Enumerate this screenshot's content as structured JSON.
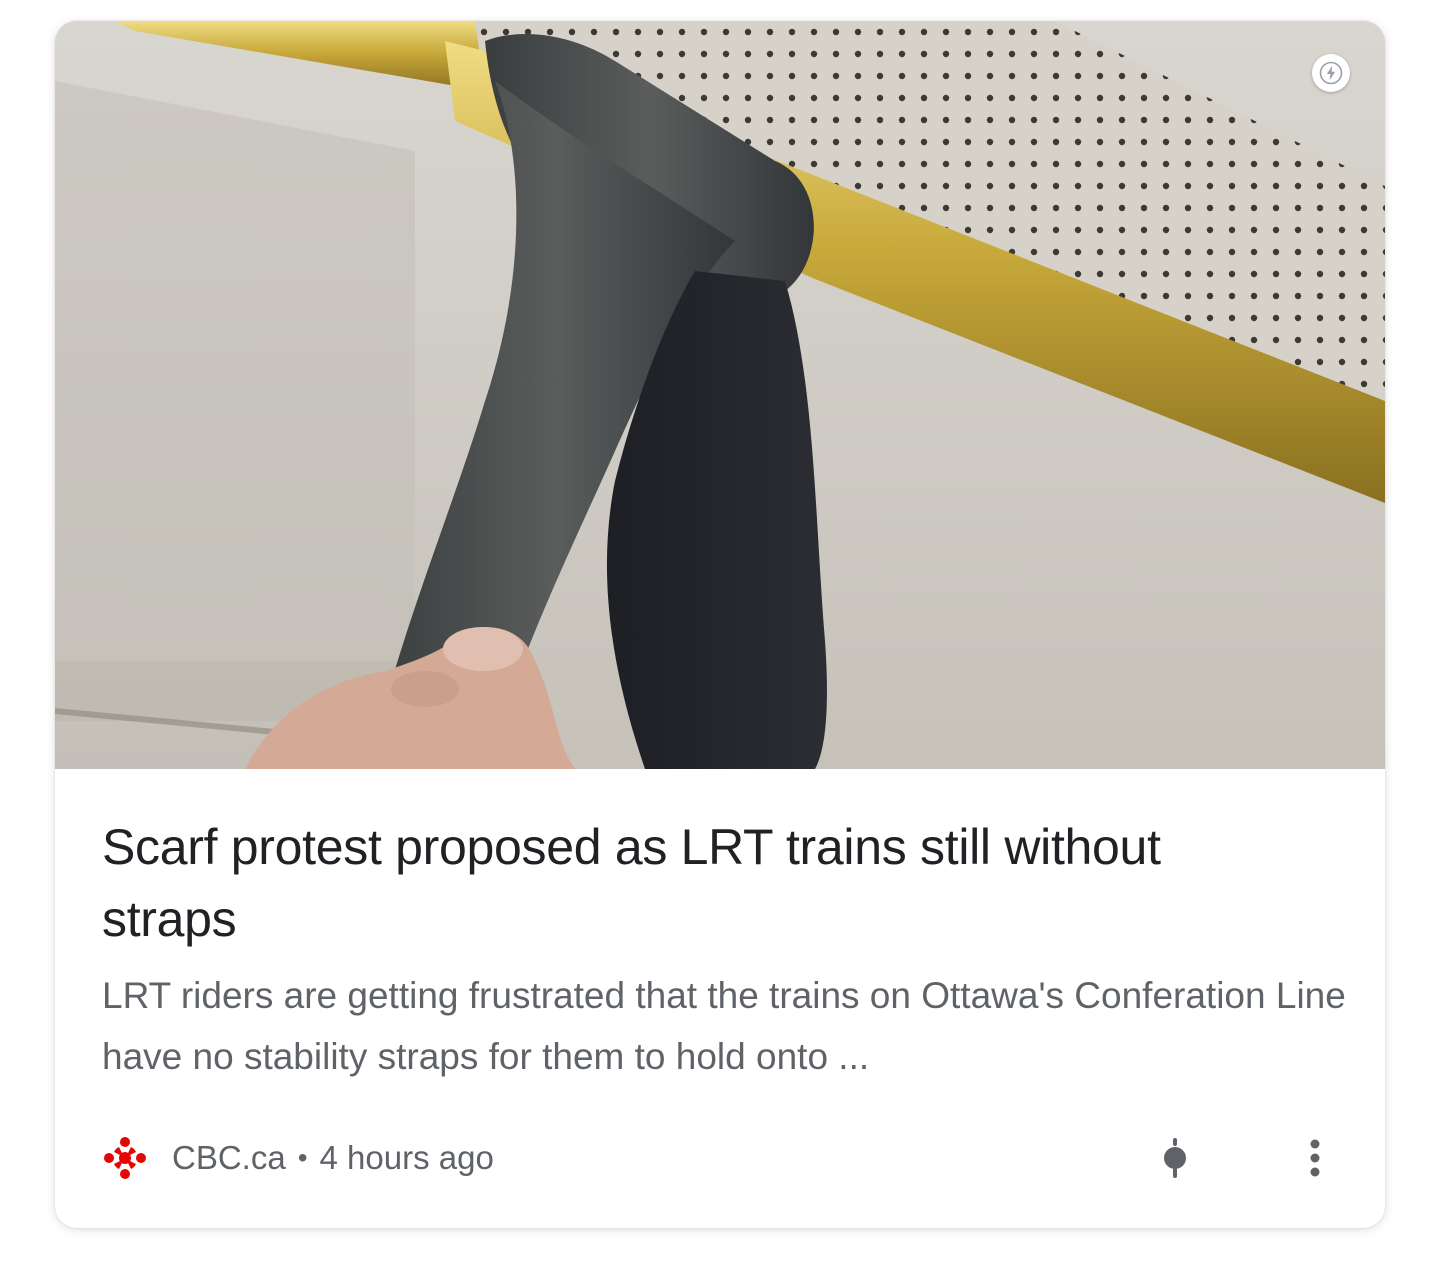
{
  "article": {
    "headline": "Scarf protest proposed as LRT trains still without straps",
    "snippet": "LRT riders are getting frustrated that the trains on Ottawa's Conferation Line have no stability straps for them to hold onto ...",
    "source": "CBC.ca",
    "separator": "•",
    "time": "4 hours ago"
  },
  "icons": {
    "amp_badge": "lightning-bolt-icon",
    "source_logo": "cbc-gem-logo",
    "pin": "pin-icon",
    "more": "more-vertical-icon"
  },
  "colors": {
    "headline": "#202124",
    "snippet": "#5f6368",
    "cbc_red": "#e60505"
  }
}
